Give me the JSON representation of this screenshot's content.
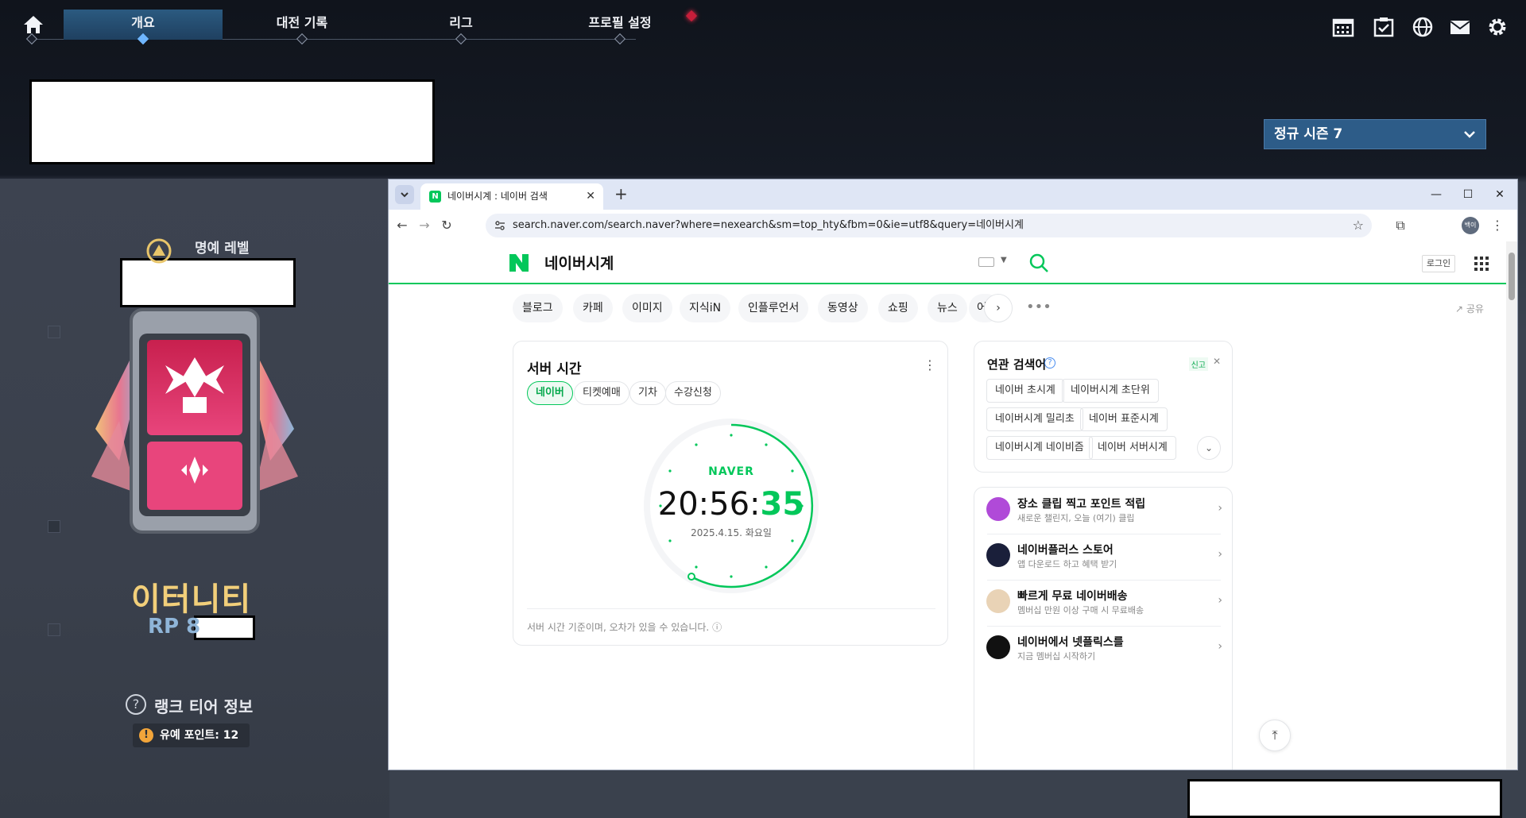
{
  "game": {
    "nav": {
      "tabs": [
        {
          "label": "개요",
          "active": true
        },
        {
          "label": "대전 기록"
        },
        {
          "label": "리그"
        },
        {
          "label": "프로필 설정"
        }
      ]
    },
    "icons": [
      "home-icon",
      "calendar-icon",
      "checklist-icon",
      "globe-icon",
      "mail-icon",
      "gear-icon"
    ],
    "season_select": {
      "value": "정규 시즌 7"
    },
    "rank": {
      "honor_level_label": "명예 레벨",
      "tier_name": "이터니티",
      "rp_label": "RP 8",
      "tier_info_label": "랭크 티어 정보",
      "penalty_label": "유예 포인트: 12",
      "tier_color": "#f2cf7a"
    }
  },
  "browser": {
    "tab": {
      "title": "네이버시계 : 네이버 검색",
      "favicon": "N"
    },
    "url": "search.naver.com/search.naver?where=nexearch&sm=top_hty&fbm=0&ie=utf8&query=네이버시계",
    "profile_label": "백이",
    "window_controls": {
      "minimize": "—",
      "maximize": "☐",
      "close": "✕"
    }
  },
  "naver": {
    "query": "네이버시계",
    "login_label": "로그인",
    "share_label": "공유",
    "accent": "#03c75a",
    "tabs": [
      "블로그",
      "카페",
      "이미지",
      "지식iN",
      "인플루언서",
      "동영상",
      "쇼핑",
      "뉴스",
      "어학사전"
    ],
    "server_time": {
      "title": "서버 시간",
      "chips": [
        "네이버",
        "티켓예매",
        "기차",
        "수강신청"
      ],
      "brand": "NAVER",
      "time_hm": "20:56:",
      "time_s": "35",
      "date": "2025.4.15. 화요일",
      "note": "서버 시간 기준이며, 오차가 있을 수 있습니다."
    },
    "related": {
      "title": "연관 검색어",
      "report_label": "신고",
      "items": [
        "네이버 초시계",
        "네이버시계 초단위",
        "네이버시계 밀리초",
        "네이버 표준시계",
        "네이버시계 네이비즘",
        "네이버 서버시계"
      ]
    },
    "promos": [
      {
        "title": "장소 클립 찍고 포인트 적립",
        "sub": "새로운 챌린지, 오늘 (여기) 클립",
        "icon_color": "#b04ad8"
      },
      {
        "title": "네이버플러스 스토어",
        "sub": "앱 다운로드 하고 혜택 받기",
        "icon_color": "#1a1f3a"
      },
      {
        "title": "빠르게 무료 네이버배송",
        "sub": "멤버십 만원 이상 구매 시 무료배송",
        "icon_color": "#e9d3b6"
      },
      {
        "title": "네이버에서 넷플릭스를",
        "sub": "지금 멤버십 시작하기",
        "icon_color": "#111111"
      }
    ]
  }
}
